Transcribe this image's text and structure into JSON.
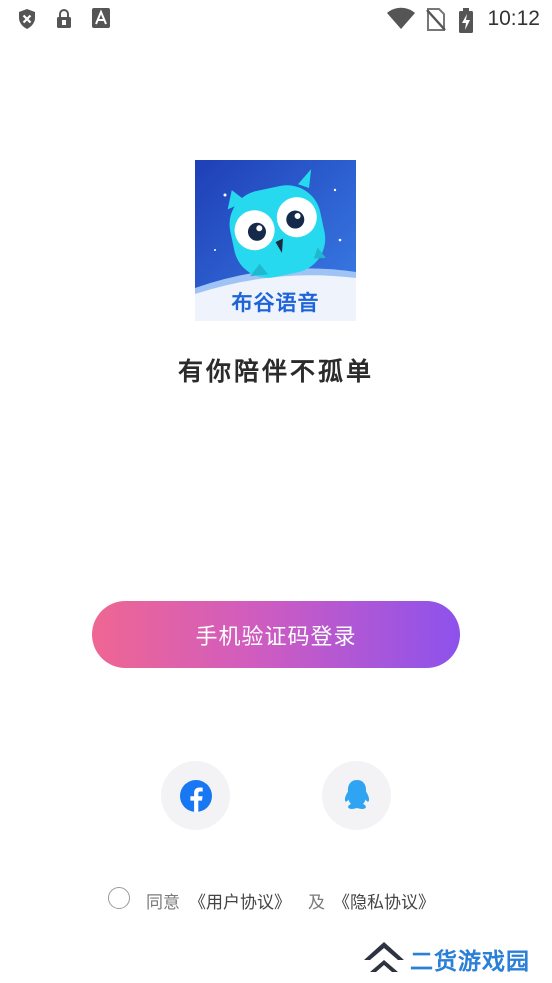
{
  "status_bar": {
    "time": "10:12",
    "icons": [
      "shield-x-icon",
      "lock-badge-icon",
      "font-a-icon",
      "wifi-icon",
      "no-sim-icon",
      "battery-charging-icon"
    ]
  },
  "app": {
    "logo_text": "布谷语音",
    "slogan": "有你陪伴不孤单"
  },
  "login": {
    "phone_button_label": "手机验证码登录"
  },
  "social": [
    "facebook-icon",
    "qq-icon"
  ],
  "agreement": {
    "prefix": "同意",
    "user_agreement": "《用户协议》",
    "and": "及",
    "privacy_agreement": "《隐私协议》"
  },
  "watermark": {
    "text": "二货游戏园"
  },
  "colors": {
    "button_gradient_start": "#ef6692",
    "button_gradient_end": "#8d52ec",
    "facebook_blue": "#1877f2",
    "qq_blue": "#2fa4f2",
    "logo_bg": "#2c55c9",
    "owl_cyan": "#27d9ee"
  }
}
